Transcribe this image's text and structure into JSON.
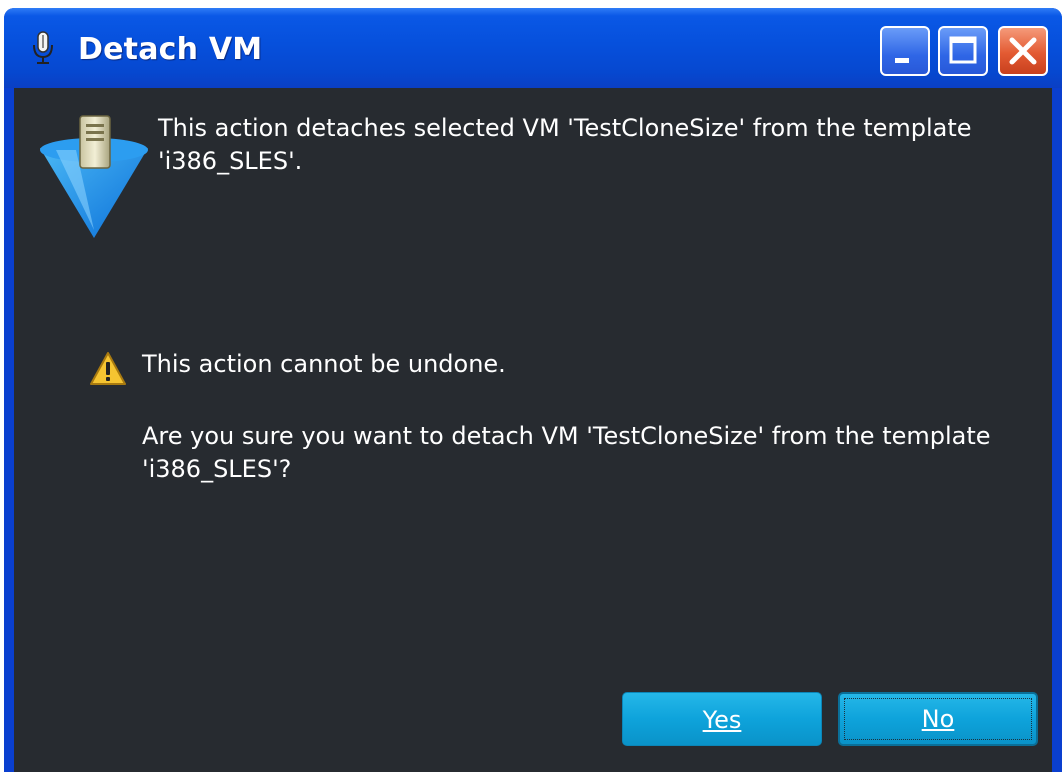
{
  "window": {
    "title": "Detach VM",
    "title_icon": "microphone-icon",
    "controls": {
      "minimize": "minimize-icon",
      "maximize": "maximize-icon",
      "close": "close-icon"
    }
  },
  "dialog": {
    "header_icon": "server-vm-icon",
    "message": "This action detaches selected VM 'TestCloneSize' from the template 'i386_SLES'.",
    "warning_icon": "warning-icon",
    "warning": "This action cannot be undone.",
    "confirm": "Are you sure you want to detach VM 'TestCloneSize' from the template 'i386_SLES'?"
  },
  "buttons": {
    "yes_label": "Yes",
    "no_label": "No"
  },
  "colors": {
    "titlebar": "#0650dc",
    "client_background": "#272b30",
    "button": "#0ea3db",
    "text": "#ffffff"
  }
}
